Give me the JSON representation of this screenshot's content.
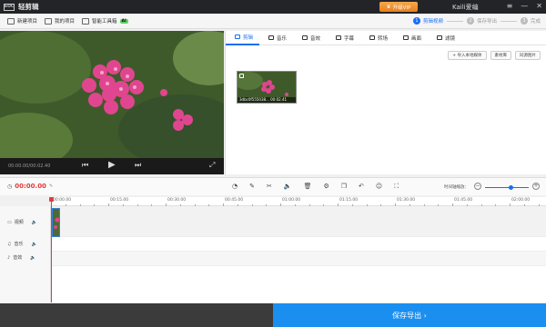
{
  "app": {
    "logo": "EOC",
    "title": "轻剪辑"
  },
  "titlebar": {
    "vip_label": "升级VIP",
    "user_name": "Kaili爱编",
    "btn_menu": "≡",
    "btn_min": "—",
    "btn_close": "✕"
  },
  "toolbar": {
    "new_project": "新建项目",
    "my_projects": "我的项目",
    "ai_tools": "智能工具箱",
    "ai_badge": "AI"
  },
  "steps": [
    {
      "num": "1",
      "label": "剪辑视频"
    },
    {
      "num": "2",
      "label": "保存导出"
    },
    {
      "num": "3",
      "label": "完成"
    }
  ],
  "preview": {
    "time": "00:00.00/00:02.40"
  },
  "panel": {
    "tabs": [
      {
        "label": "剪辑",
        "icon": "video-icon"
      },
      {
        "label": "音乐",
        "icon": "music-icon"
      },
      {
        "label": "音效",
        "icon": "sound-effect-icon"
      },
      {
        "label": "字幕",
        "icon": "text-icon"
      },
      {
        "label": "转场",
        "icon": "transition-icon"
      },
      {
        "label": "画面",
        "icon": "picture-icon"
      },
      {
        "label": "滤镜",
        "icon": "filter-icon"
      }
    ],
    "actions": {
      "import": "+ 导入本地媒体",
      "library": "素材库",
      "same_pic": "同源图片"
    },
    "clip": {
      "name": "3dbc0f555038...",
      "duration": "00:02.41"
    }
  },
  "timeline": {
    "current_time": "00:00.00",
    "zoom_label": "时间轴缩放：",
    "zoom_level": 0.6,
    "ruler": [
      "00:00.00",
      "00:15.00",
      "00:30.00",
      "00:45.00",
      "01:00.00",
      "01:15.00",
      "01:30.00",
      "01:45.00",
      "02:00.00"
    ],
    "tracks": [
      {
        "label": "视频",
        "icon": "video-track-icon"
      },
      {
        "label": "音乐",
        "icon": "music-track-icon"
      },
      {
        "label": "音效",
        "icon": "sound-track-icon"
      }
    ]
  },
  "export": {
    "label": "保存导出 ›"
  },
  "colors": {
    "accent": "#1b6ef2",
    "export": "#1a8ff0",
    "playhead": "#e23c3c",
    "vip": "#f28d2b"
  }
}
